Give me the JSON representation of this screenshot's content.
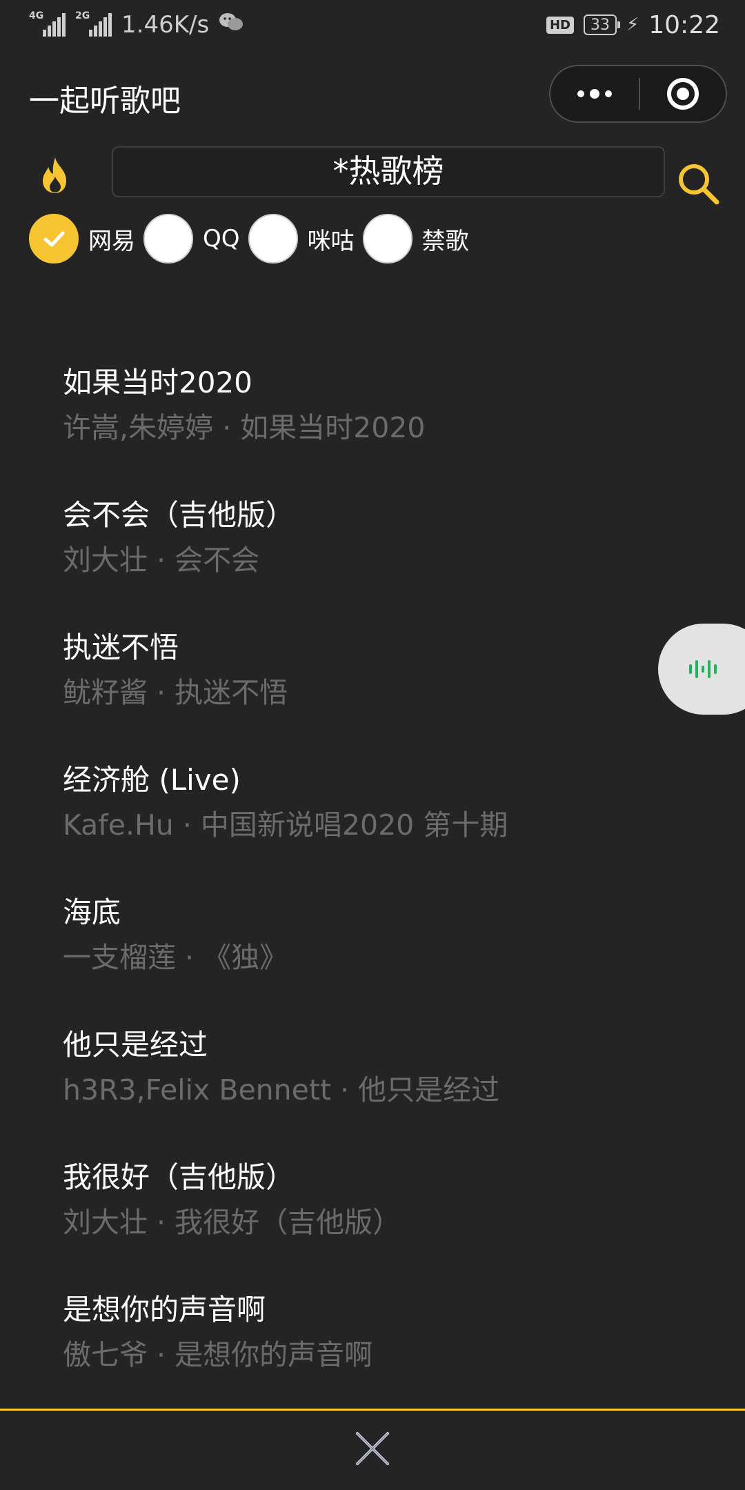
{
  "status_bar": {
    "net1": "4G",
    "net2": "2G",
    "speed": "1.46K/s",
    "hd": "HD",
    "battery": "33",
    "time": "10:22",
    "icons": [
      "signal-icon",
      "wechat-icon",
      "charging-icon"
    ]
  },
  "header": {
    "title": "一起听歌吧",
    "capsule_icons": [
      "more-dots-icon",
      "target-icon"
    ]
  },
  "search": {
    "value": "*热歌榜",
    "icon": "search-icon",
    "hot_icon": "fire-icon"
  },
  "sources": [
    {
      "label": "网易",
      "checked": true
    },
    {
      "label": "QQ",
      "checked": false
    },
    {
      "label": "咪咕",
      "checked": false
    },
    {
      "label": "禁歌",
      "checked": false
    }
  ],
  "songs": [
    {
      "title": "如果当时2020",
      "subtitle": "许嵩,朱婷婷 · 如果当时2020"
    },
    {
      "title": "会不会（吉他版）",
      "subtitle": "刘大壮 · 会不会"
    },
    {
      "title": "执迷不悟",
      "subtitle": "鱿籽酱 · 执迷不悟"
    },
    {
      "title": "经济舱 (Live)",
      "subtitle": "Kafe.Hu · 中国新说唱2020 第十期"
    },
    {
      "title": "海底",
      "subtitle": "一支榴莲 · 《独》"
    },
    {
      "title": "他只是经过",
      "subtitle": "h3R3,Felix Bennett · 他只是经过"
    },
    {
      "title": "我很好（吉他版）",
      "subtitle": "刘大壮 · 我很好（吉他版）"
    },
    {
      "title": "是想你的声音啊",
      "subtitle": "傲七爷 · 是想你的声音啊"
    }
  ],
  "colors": {
    "accent": "#f7c531",
    "background": "#242424",
    "player_wave": "#22b35a"
  }
}
